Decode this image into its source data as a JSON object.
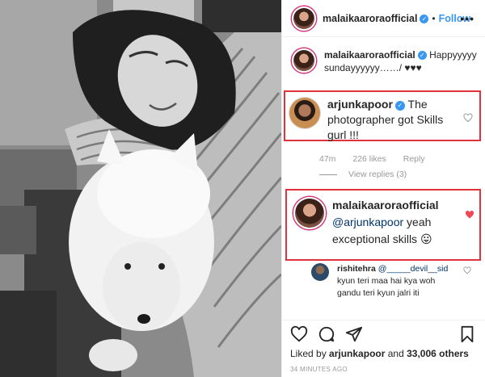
{
  "post": {
    "author": "malaikaaroraofficial",
    "follow_label": "Follow",
    "separator": "•",
    "more_icon": "more-icon"
  },
  "caption": {
    "author": "malaikaaroraofficial",
    "text": "Happyyyyy sundayyyyyy……/ ♥♥♥"
  },
  "comments": [
    {
      "author": "arjunkapoor",
      "text": "The photographer got Skills gurl !!!",
      "time": "47m",
      "likes": "226 likes",
      "reply_label": "Reply",
      "view_replies": "View replies (3)",
      "liked": false
    },
    {
      "author": "malaikaaroraofficial",
      "mention": "@arjunkapoor",
      "text": "yeah exceptional skills 😛",
      "liked": true
    },
    {
      "author": "rishitehra",
      "mention": "@_____devil__sid",
      "text": "kyun teri maa hai kya woh gandu teri kyun jalri iti",
      "liked": false
    }
  ],
  "likes": {
    "prefix": "Liked by",
    "user": "arjunkapoor",
    "middle": "and",
    "count": "33,006 others"
  },
  "timestamp": "34 MINUTES AGO",
  "colors": {
    "accent": "#3897f0",
    "highlight_border": "#e2333c",
    "like_red": "#ed4956",
    "muted": "#999999"
  }
}
